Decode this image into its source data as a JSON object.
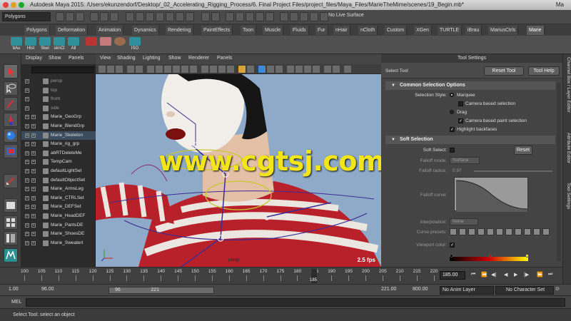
{
  "window": {
    "app_name": "Autodesk Maya 2015",
    "title": "Autodesk Maya 2015: /Users/ekunzendorf/Desktop/_02_Accelerating_Rigging_Process/6. Final Project Files/project_files/Maya_Files/MarieTheMime/scenes/19_Begin.mb*",
    "menu_title_right": "Ma"
  },
  "status_line": {
    "menu_set": "Polygons",
    "live_surface": "No Live Surface"
  },
  "shelf": {
    "tabs": [
      "Polygons",
      "Deformation",
      "Animation",
      "Dynamics",
      "Rendering",
      "PaintEffects",
      "Toon",
      "Muscle",
      "Fluids",
      "Fur",
      "nHair",
      "nCloth",
      "Custom",
      "XGen",
      "TURTLE",
      "iBrau",
      "MariusCtrls",
      "Marie"
    ],
    "active_tab": "Marie",
    "buttons": [
      "bAu",
      "Hist",
      "Skel",
      "sknCl",
      "All",
      "",
      "",
      "ISO"
    ]
  },
  "outliner": {
    "menu": [
      "Display",
      "Show",
      "Panels"
    ],
    "items": [
      {
        "label": "persp",
        "dim": true
      },
      {
        "label": "top",
        "dim": true
      },
      {
        "label": "front",
        "dim": true
      },
      {
        "label": "side",
        "dim": true
      },
      {
        "label": "Marie_GeoGrp",
        "dim": false
      },
      {
        "label": "Marie_BlendGrp",
        "dim": false
      },
      {
        "label": "Marie_Skeleton",
        "dim": false
      },
      {
        "label": "Marie_rig_grp",
        "dim": false
      },
      {
        "label": "abRTDeleteMe",
        "dim": false
      },
      {
        "label": "TempCam",
        "dim": false
      },
      {
        "label": "defaultLightSet",
        "dim": false
      },
      {
        "label": "defaultObjectSet",
        "dim": false
      },
      {
        "label": "Marie_ArmsLeg",
        "dim": false
      },
      {
        "label": "Marie_CTRLSet",
        "dim": false
      },
      {
        "label": "Marie_DEFSet",
        "dim": false
      },
      {
        "label": "Marie_HeadDEF",
        "dim": false
      },
      {
        "label": "Marie_PantsDE",
        "dim": false
      },
      {
        "label": "Marie_ShoesDE",
        "dim": false
      },
      {
        "label": "Marie_SweaterI",
        "dim": false
      }
    ]
  },
  "viewport": {
    "menu": [
      "View",
      "Shading",
      "Lighting",
      "Show",
      "Renderer",
      "Panels"
    ],
    "camera_label": "persp",
    "fps": "2.5 fps",
    "watermark": "www.cgtsj.com"
  },
  "tool_settings": {
    "header": "Tool Settings",
    "tool_name": "Select Tool",
    "reset_tool": "Reset Tool",
    "tool_help": "Tool Help",
    "common_section": "Common Selection Options",
    "selection_style_label": "Selection Style:",
    "marquee": "Marquee",
    "camera_based_selection": "Camera based selection",
    "drag": "Drag",
    "camera_based_paint": "Camera based paint selection",
    "highlight_backfaces": "Highlight backfaces",
    "soft_section": "Soft Selection",
    "soft_select_label": "Soft Select:",
    "reset": "Reset",
    "falloff_mode_label": "Falloff mode:",
    "falloff_mode_value": "Surface",
    "falloff_radius_label": "Falloff radius:",
    "falloff_radius_value": "0.97",
    "falloff_curve_label": "Falloff curve:",
    "interpolation_label": "Interpolation:",
    "interpolation_value": "None",
    "curve_presets_label": "Curve presets:",
    "viewport_color_label": "Viewport color:"
  },
  "right_tabs": [
    "Channel Box / Layer Editor",
    "Attribute Editor",
    "Tool Settings"
  ],
  "time_slider": {
    "ticks": [
      "100",
      "105",
      "110",
      "115",
      "120",
      "125",
      "130",
      "135",
      "140",
      "145",
      "150",
      "155",
      "160",
      "165",
      "170",
      "175",
      "180",
      "185",
      "190",
      "195",
      "200",
      "205",
      "210",
      "215",
      "220"
    ],
    "current_frame": "185",
    "current_frame_field": "185.00"
  },
  "range_slider": {
    "start": "1.00",
    "playback_start": "96.00",
    "slider_start": "96",
    "slider_end": "221",
    "playback_end": "221.00",
    "end": "800.00",
    "anim_layer": "No Anim Layer",
    "character_set": "No Character Set"
  },
  "command_line": {
    "label": "MEL"
  },
  "help_line": {
    "text": "Select Tool: select an object"
  }
}
